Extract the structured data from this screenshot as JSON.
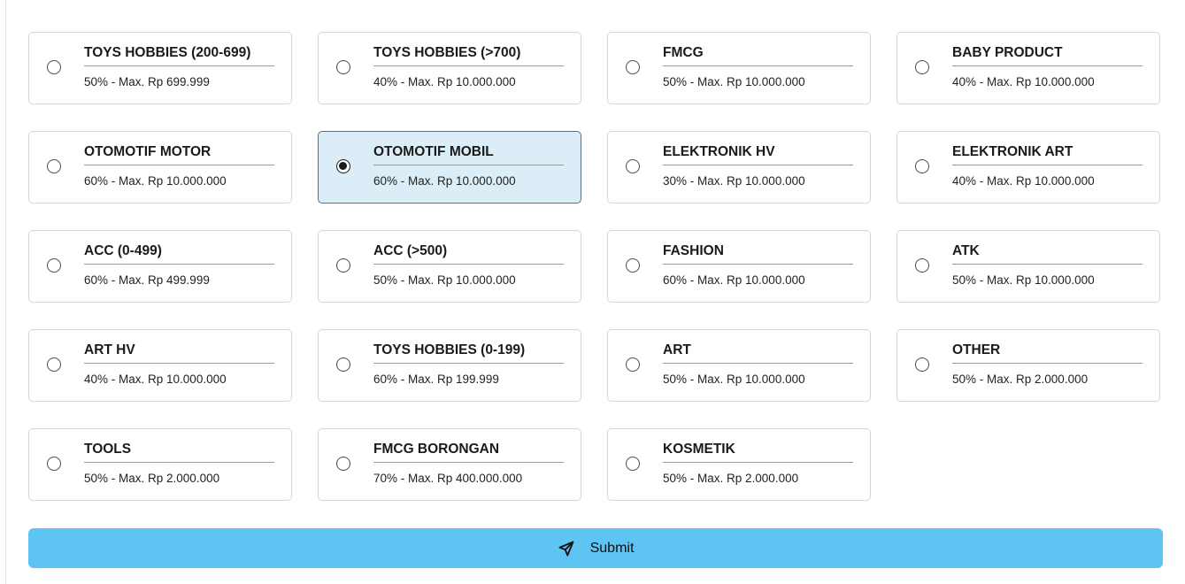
{
  "options": [
    {
      "title": "TOYS HOBBIES (200-699)",
      "desc": "50% - Max. Rp 699.999",
      "selected": false
    },
    {
      "title": "TOYS HOBBIES (>700)",
      "desc": "40% - Max. Rp 10.000.000",
      "selected": false
    },
    {
      "title": "FMCG",
      "desc": "50% - Max. Rp 10.000.000",
      "selected": false
    },
    {
      "title": "BABY PRODUCT",
      "desc": "40% - Max. Rp 10.000.000",
      "selected": false
    },
    {
      "title": "OTOMOTIF MOTOR",
      "desc": "60% - Max. Rp 10.000.000",
      "selected": false
    },
    {
      "title": "OTOMOTIF MOBIL",
      "desc": "60% - Max. Rp 10.000.000",
      "selected": true
    },
    {
      "title": "ELEKTRONIK HV",
      "desc": "30% - Max. Rp 10.000.000",
      "selected": false
    },
    {
      "title": "ELEKTRONIK ART",
      "desc": "40% - Max. Rp 10.000.000",
      "selected": false
    },
    {
      "title": "ACC (0-499)",
      "desc": "60% - Max. Rp 499.999",
      "selected": false
    },
    {
      "title": "ACC (>500)",
      "desc": "50% - Max. Rp 10.000.000",
      "selected": false
    },
    {
      "title": "FASHION",
      "desc": "60% - Max. Rp 10.000.000",
      "selected": false
    },
    {
      "title": "ATK",
      "desc": "50% - Max. Rp 10.000.000",
      "selected": false
    },
    {
      "title": "ART HV",
      "desc": "40% - Max. Rp 10.000.000",
      "selected": false
    },
    {
      "title": "TOYS HOBBIES (0-199)",
      "desc": "60% - Max. Rp 199.999",
      "selected": false
    },
    {
      "title": "ART",
      "desc": "50% - Max. Rp 10.000.000",
      "selected": false
    },
    {
      "title": "OTHER",
      "desc": "50% - Max. Rp 2.000.000",
      "selected": false
    },
    {
      "title": "TOOLS",
      "desc": "50% - Max. Rp 2.000.000",
      "selected": false
    },
    {
      "title": "FMCG BORONGAN",
      "desc": "70% - Max. Rp 400.000.000",
      "selected": false
    },
    {
      "title": "KOSMETIK",
      "desc": "50% - Max. Rp 2.000.000",
      "selected": false
    }
  ],
  "submit": {
    "label": "Submit",
    "icon": "send-icon"
  },
  "colors": {
    "selected_bg": "#dbeef8",
    "selected_border": "#5b6f80",
    "submit_bg": "#5ec4f3"
  }
}
